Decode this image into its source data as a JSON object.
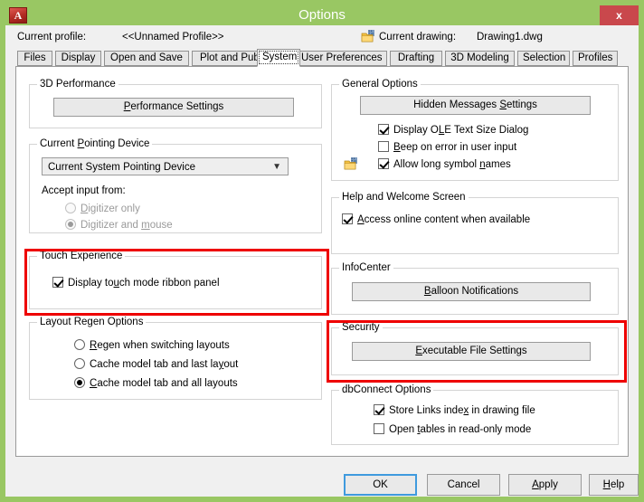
{
  "window": {
    "title": "Options",
    "logo_icon": "autocad-logo-icon",
    "logo_glyph": "A",
    "close_label": "x"
  },
  "profile_row": {
    "current_profile_label": "Current profile:",
    "current_profile_value": "<<Unnamed Profile>>",
    "drawing_icon": "drawing-file-icon",
    "current_drawing_label": "Current drawing:",
    "current_drawing_value": "Drawing1.dwg"
  },
  "tabs": [
    {
      "label": "Files",
      "active": false
    },
    {
      "label": "Display",
      "active": false
    },
    {
      "label": "Open and Save",
      "active": false
    },
    {
      "label": "Plot and Publish",
      "active": false
    },
    {
      "label": "System",
      "active": true
    },
    {
      "label": "User Preferences",
      "active": false
    },
    {
      "label": "Drafting",
      "active": false
    },
    {
      "label": "3D Modeling",
      "active": false
    },
    {
      "label": "Selection",
      "active": false
    },
    {
      "label": "Profiles",
      "active": false
    }
  ],
  "left_column": {
    "performance": {
      "title": "3D Performance",
      "button_label": "Performance Settings",
      "button_mnemonic": "P"
    },
    "pointing_device": {
      "title": "Current Pointing Device",
      "title_mnemonic": "P",
      "combo_value": "Current System Pointing Device",
      "combo_arrow": "chevron-down-icon",
      "accept_input_label": "Accept input from:",
      "options": [
        {
          "label": "Digitizer only",
          "mnemonic": "D",
          "selected": false,
          "disabled": true
        },
        {
          "label": "Digitizer and mouse",
          "mnemonic": "m",
          "selected": true,
          "disabled": true
        }
      ]
    },
    "touch_experience": {
      "title": "Touch Experience",
      "highlighted": true,
      "checkbox_label": "Display touch mode ribbon panel",
      "checkbox_mnemonic": "u",
      "checked": true
    },
    "layout_regen": {
      "title": "Layout Regen Options",
      "options": [
        {
          "label": "Regen when switching layouts",
          "mnemonic": "R",
          "selected": false
        },
        {
          "label": "Cache model tab and last layout",
          "mnemonic": "y",
          "selected": false
        },
        {
          "label": "Cache model tab and all layouts",
          "mnemonic": "C",
          "selected": true
        }
      ]
    }
  },
  "right_column": {
    "general_options": {
      "title": "General Options",
      "button_label": "Hidden Messages Settings",
      "button_mnemonic": "S",
      "checkboxes": [
        {
          "label": "Display OLE Text Size Dialog",
          "mnemonic": "L",
          "checked": true,
          "icon": null
        },
        {
          "label": "Beep on error in user input",
          "mnemonic": "B",
          "checked": false,
          "icon": null
        },
        {
          "label": "Allow long symbol names",
          "mnemonic": "n",
          "checked": true,
          "icon": "drawing-file-icon"
        }
      ]
    },
    "help_welcome": {
      "title": "Help and Welcome Screen",
      "checkbox_label": "Access online content when available",
      "checkbox_mnemonic": "A",
      "checked": true
    },
    "infocenter": {
      "title": "InfoCenter",
      "button_label": "Balloon Notifications",
      "button_mnemonic": "B"
    },
    "security": {
      "title": "Security",
      "highlighted": true,
      "button_label": "Executable File Settings",
      "button_mnemonic": "E"
    },
    "dbconnect": {
      "title": "dbConnect Options",
      "checkboxes": [
        {
          "label": "Store Links index in drawing file",
          "mnemonic": "x",
          "checked": true
        },
        {
          "label": "Open tables in read-only mode",
          "mnemonic": "t",
          "checked": false
        }
      ]
    }
  },
  "footer": {
    "ok_label": "OK",
    "cancel_label": "Cancel",
    "apply_label": "Apply",
    "apply_mnemonic": "A",
    "help_label": "Help",
    "help_mnemonic": "H"
  },
  "colors": {
    "title_bar": "#99c763",
    "close_button": "#c9484c",
    "annotation_red": "#ee0000",
    "default_button_focus": "#3f9ade",
    "panel_background": "#ffffff",
    "dialog_background": "#f0f0f0"
  }
}
